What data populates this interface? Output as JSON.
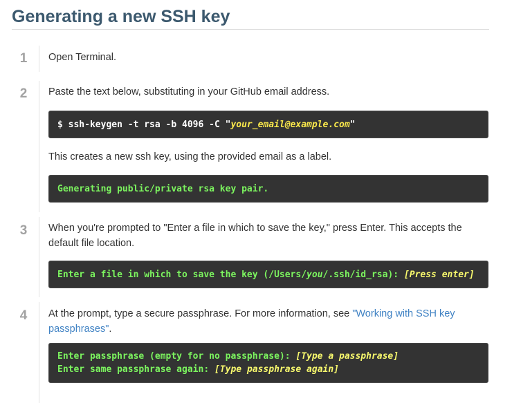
{
  "title": "Generating a new SSH key",
  "steps": [
    {
      "num": "1",
      "text": "Open Terminal."
    },
    {
      "num": "2",
      "text": "Paste the text below, substituting in your GitHub email address.",
      "code1": {
        "prompt": "$ ssh-keygen -t rsa -b 4096 -C \"",
        "email": "your_email@example.com",
        "close": "\""
      },
      "note": "This creates a new ssh key, using the provided email as a label.",
      "code2": "Generating public/private rsa key pair."
    },
    {
      "num": "3",
      "text": "When you're prompted to \"Enter a file in which to save the key,\" press Enter. This accepts the default file location.",
      "code": {
        "before": "Enter a file in which to save the key (/Users/",
        "you": "you",
        "after": "/.ssh/id_rsa): ",
        "action": "[Press enter]"
      }
    },
    {
      "num": "4",
      "text_before": "At the prompt, type a secure passphrase. For more information, see ",
      "link": "\"Working with SSH key passphrases\"",
      "text_after": ".",
      "code_lines": [
        {
          "label": "Enter passphrase (empty for no passphrase): ",
          "action": "[Type a passphrase]"
        },
        {
          "label": "Enter same passphrase again: ",
          "action": "[Type passphrase again]"
        }
      ]
    }
  ],
  "colors": {
    "title": "#3c596e",
    "link": "#4183c4",
    "code_bg": "#333333",
    "code_green": "#7cf55f",
    "code_yellow": "#fbe94b"
  }
}
